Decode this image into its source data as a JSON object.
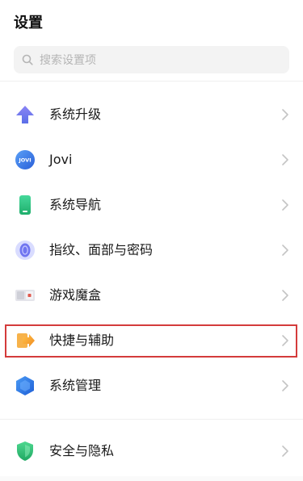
{
  "header": {
    "title": "设置"
  },
  "search": {
    "placeholder": "搜索设置项",
    "icon": "search-icon"
  },
  "items": [
    {
      "label": "系统升级",
      "icon": "upgrade-arrow-icon",
      "color": "#6f7cf0"
    },
    {
      "label": "Jovi",
      "icon": "jovi-icon",
      "color": "#3a7df0"
    },
    {
      "label": "系统导航",
      "icon": "phone-navigation-icon",
      "color": "#2ec27e"
    },
    {
      "label": "指纹、面部与密码",
      "icon": "fingerprint-icon",
      "color": "#6b6ff5"
    },
    {
      "label": "游戏魔盒",
      "icon": "game-box-icon",
      "color": "#e05a4f"
    },
    {
      "label": "快捷与辅助",
      "icon": "shortcut-arrow-icon",
      "color": "#f29a2e"
    },
    {
      "label": "系统管理",
      "icon": "hexagon-icon",
      "color": "#2f7fe6"
    },
    {
      "label": "安全与隐私",
      "icon": "shield-icon",
      "color": "#2bb673"
    }
  ],
  "highlight": {
    "color": "#d43b3b"
  }
}
